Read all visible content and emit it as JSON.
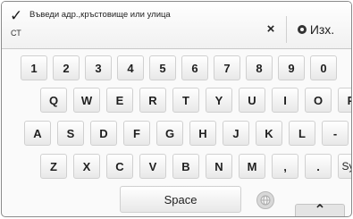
{
  "header": {
    "check_icon": "✓",
    "mode_label": "СТ",
    "input_text": "Въведи адр.,кръстовище или улица",
    "clear_icon": "×",
    "exit_label": "Изх."
  },
  "keyboard": {
    "row1": [
      "1",
      "2",
      "3",
      "4",
      "5",
      "6",
      "7",
      "8",
      "9",
      "0"
    ],
    "row2": [
      "Q",
      "W",
      "E",
      "R",
      "T",
      "Y",
      "U",
      "I",
      "O",
      "P"
    ],
    "row3": [
      "A",
      "S",
      "D",
      "F",
      "G",
      "H",
      "J",
      "K",
      "L",
      "-"
    ],
    "row4": [
      "Z",
      "X",
      "C",
      "V",
      "B",
      "N",
      "M",
      ",",
      "."
    ],
    "sym_label": "Sym",
    "space_label": "Space",
    "collapse_icon": "⌃"
  },
  "icons": {
    "check": "check-icon",
    "clear": "close-icon",
    "exit": "exit-icon",
    "globe": "globe-icon",
    "collapse": "chevron-up-icon"
  }
}
